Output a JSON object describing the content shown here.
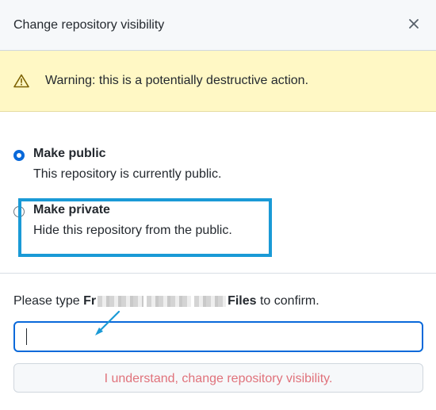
{
  "dialog": {
    "title": "Change repository visibility",
    "close_icon": "close-icon"
  },
  "warning": {
    "icon": "alert-triangle-icon",
    "text": "Warning: this is a potentially destructive action."
  },
  "options": [
    {
      "label": "Make public",
      "description": "This repository is currently public.",
      "checked": true
    },
    {
      "label": "Make private",
      "description": "Hide this repository from the public.",
      "checked": false
    }
  ],
  "confirm": {
    "prefix": "Please type ",
    "repo_name_start": "Fr",
    "repo_name_end": "Files",
    "suffix": " to confirm.",
    "input_value": ""
  },
  "submit": {
    "label": "I understand, change repository visibility."
  },
  "colors": {
    "accent": "#0969da",
    "warning_bg": "#fff8c5",
    "annotation": "#1a9ad6",
    "danger_text": "#e0727b"
  }
}
